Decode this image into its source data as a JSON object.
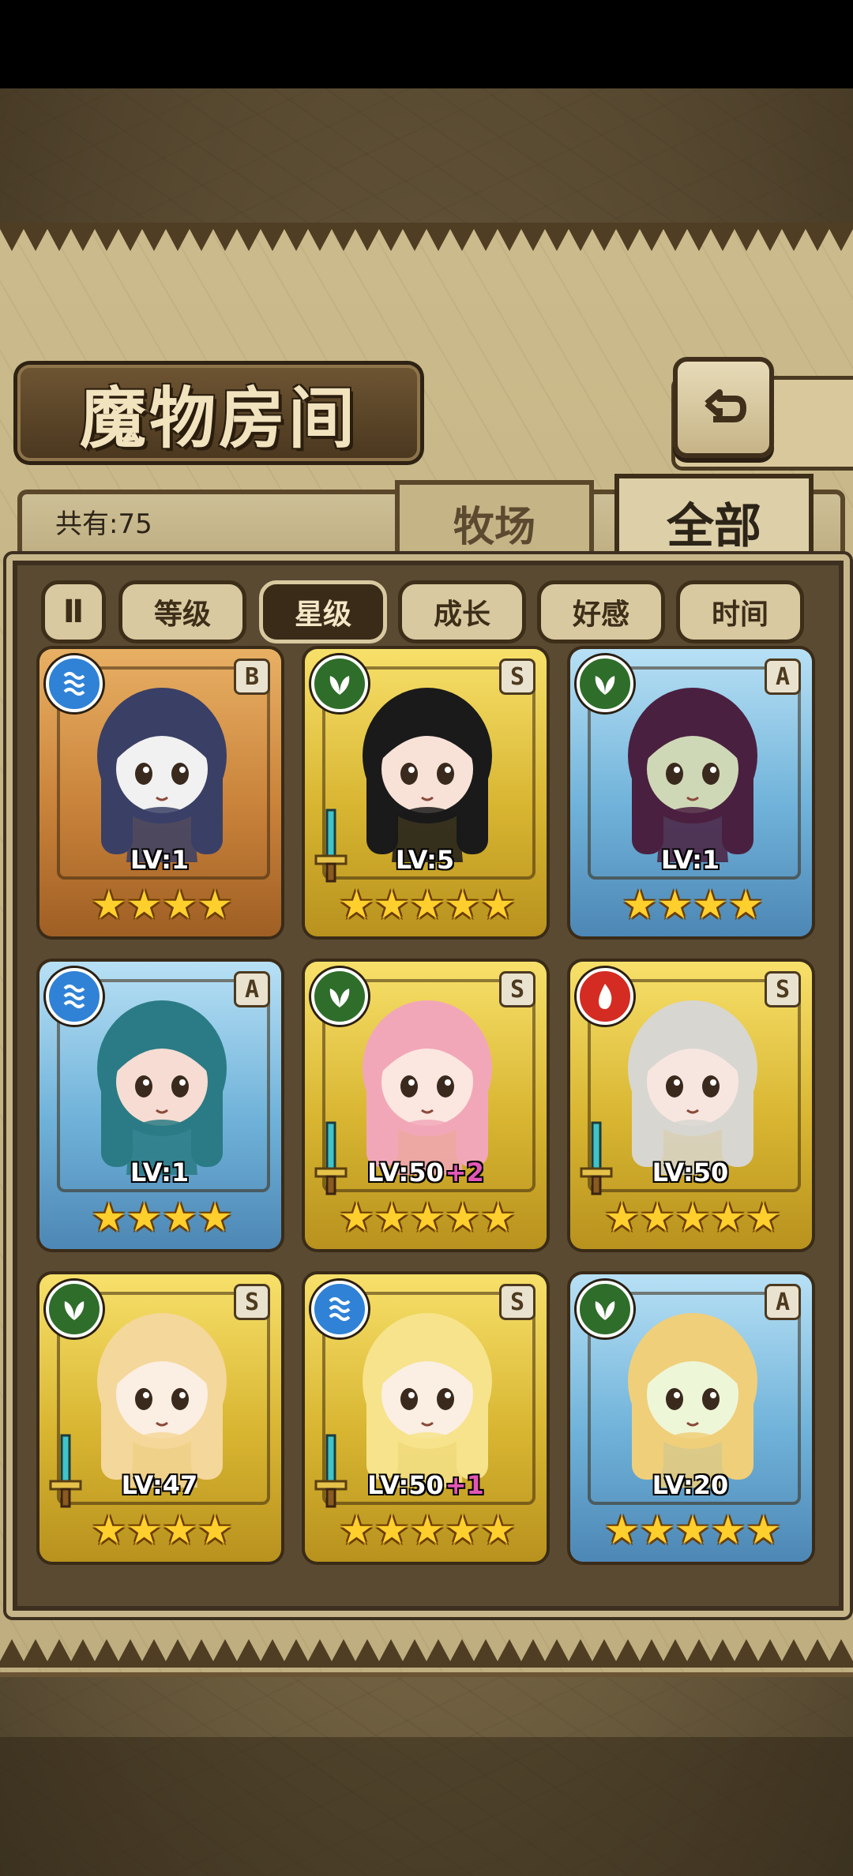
{
  "window": {
    "title": "魔物房间"
  },
  "header": {
    "count_text": "共有:75"
  },
  "tabs": [
    {
      "label": "牧场"
    },
    {
      "label": "全部"
    }
  ],
  "sort": {
    "toggle_label": "Ⅱ",
    "buttons": [
      {
        "label": "等级",
        "active": false
      },
      {
        "label": "星级",
        "active": true
      },
      {
        "label": "成长",
        "active": false
      },
      {
        "label": "好感",
        "active": false
      },
      {
        "label": "时间",
        "active": false
      }
    ]
  },
  "cards": [
    {
      "level": "LV:1",
      "bonus": "",
      "rank": "B",
      "element": "water",
      "stars": "★★★★",
      "frame": "bronze",
      "sword": false
    },
    {
      "level": "LV:5",
      "bonus": "",
      "rank": "S",
      "element": "plant",
      "stars": "★★★★★",
      "frame": "gold",
      "sword": true
    },
    {
      "level": "LV:1",
      "bonus": "",
      "rank": "A",
      "element": "plant",
      "stars": "★★★★",
      "frame": "blue",
      "sword": false
    },
    {
      "level": "LV:1",
      "bonus": "",
      "rank": "A",
      "element": "water",
      "stars": "★★★★",
      "frame": "blue",
      "sword": false
    },
    {
      "level": "LV:50",
      "bonus": "+2",
      "rank": "S",
      "element": "plant",
      "stars": "★★★★★",
      "frame": "gold",
      "sword": true
    },
    {
      "level": "LV:50",
      "bonus": "",
      "rank": "S",
      "element": "fire",
      "stars": "★★★★★",
      "frame": "gold",
      "sword": true
    },
    {
      "level": "LV:47",
      "bonus": "",
      "rank": "S",
      "element": "plant",
      "stars": "★★★★",
      "frame": "gold",
      "sword": true
    },
    {
      "level": "LV:50",
      "bonus": "+1",
      "rank": "S",
      "element": "water",
      "stars": "★★★★★",
      "frame": "gold",
      "sword": true
    },
    {
      "level": "LV:20",
      "bonus": "",
      "rank": "A",
      "element": "plant",
      "stars": "★★★★★",
      "frame": "blue",
      "sword": false
    }
  ],
  "colors": {
    "gold_frame": "#d8b531",
    "blue_frame": "#6fb2d9",
    "bronze_frame": "#c9823a",
    "level_bonus": "#e257b6",
    "star": "#ffcf2e"
  }
}
